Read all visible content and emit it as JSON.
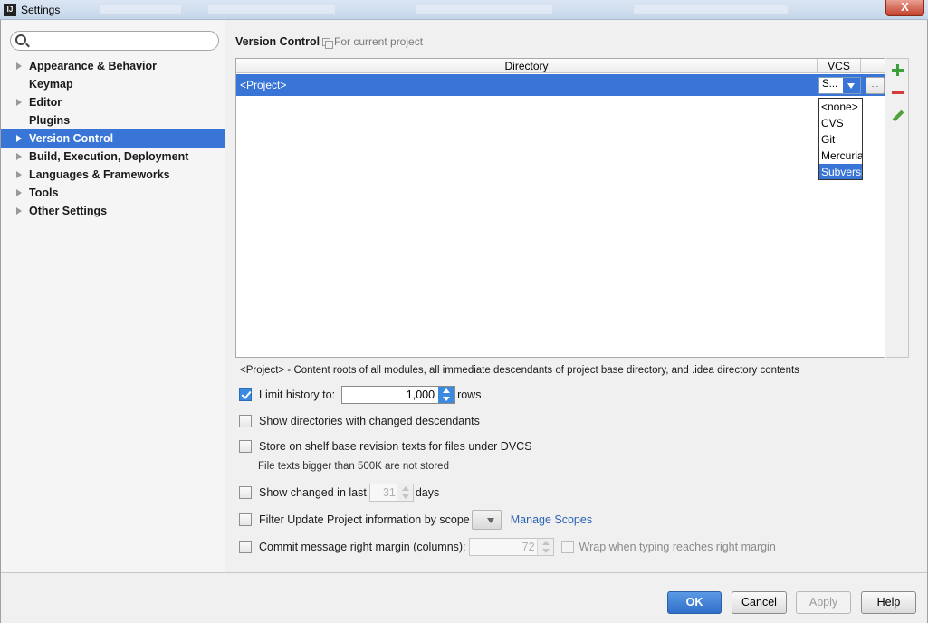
{
  "window": {
    "title": "Settings",
    "close_glyph": "X",
    "app_icon": "IJ"
  },
  "search": {
    "value": "",
    "placeholder": ""
  },
  "sidebar": {
    "items": [
      {
        "label": "Appearance & Behavior",
        "expandable": true
      },
      {
        "label": "Keymap",
        "expandable": false
      },
      {
        "label": "Editor",
        "expandable": true
      },
      {
        "label": "Plugins",
        "expandable": false
      },
      {
        "label": "Version Control",
        "expandable": true,
        "selected": true
      },
      {
        "label": "Build, Execution, Deployment",
        "expandable": true
      },
      {
        "label": "Languages & Frameworks",
        "expandable": true
      },
      {
        "label": "Tools",
        "expandable": true
      },
      {
        "label": "Other Settings",
        "expandable": true
      }
    ]
  },
  "header": {
    "title": "Version Control",
    "scope_label": "For current project"
  },
  "table": {
    "col_directory": "Directory",
    "col_vcs": "VCS",
    "row": {
      "directory": "<Project>",
      "vcs_value": "S...",
      "more_label": "..."
    },
    "vcs_options": [
      "<none>",
      "CVS",
      "Git",
      "Mercurial",
      "Subversion"
    ],
    "vcs_selected": "Subversion"
  },
  "note": "<Project> - Content roots of all modules, all immediate descendants of project base directory, and .idea directory contents",
  "options": {
    "limit_history": {
      "label": "Limit history to:",
      "checked": true,
      "value": "1,000",
      "unit": "rows"
    },
    "show_dirs": {
      "label": "Show directories with changed descendants",
      "checked": false
    },
    "store_shelf": {
      "label": "Store on shelf base revision texts for files under DVCS",
      "checked": false,
      "note": "File texts bigger than 500K are not stored"
    },
    "show_changed": {
      "label": "Show changed in last",
      "checked": false,
      "value": "31",
      "unit": "days"
    },
    "filter_update": {
      "label": "Filter Update Project information by scope",
      "checked": false,
      "link": "Manage Scopes"
    },
    "commit_margin": {
      "label": "Commit message right margin (columns):",
      "checked": false,
      "value": "72",
      "wrap_label": "Wrap when typing reaches right margin",
      "wrap_checked": false
    }
  },
  "buttons": {
    "ok": "OK",
    "cancel": "Cancel",
    "apply": "Apply",
    "help": "Help"
  },
  "colors": {
    "selection": "#3875d7",
    "link": "#2b61b3",
    "add": "#3aa13a",
    "remove": "#d63b3b"
  },
  "icons": {
    "search": "search-icon",
    "add": "plus-icon",
    "remove": "minus-icon",
    "edit": "pencil-icon",
    "expand": "triangle-right-icon"
  }
}
